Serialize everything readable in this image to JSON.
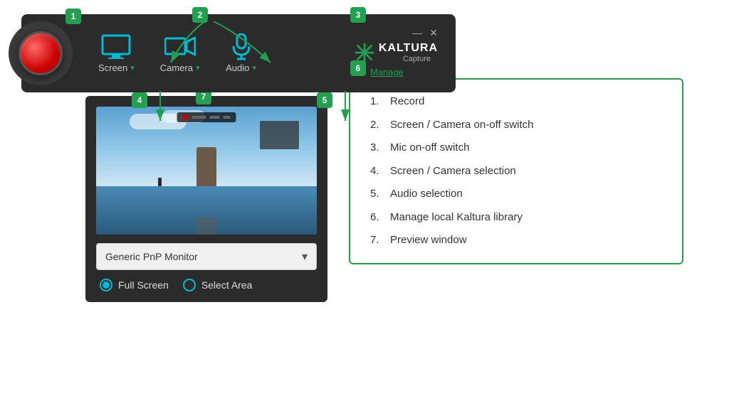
{
  "badges": {
    "b1": "1",
    "b2": "2",
    "b3": "3",
    "b7": "7",
    "b6": "6",
    "b4": "4",
    "b5": "5"
  },
  "toolbar": {
    "screen_label": "Screen",
    "camera_label": "Camera",
    "audio_label": "Audio"
  },
  "kaltura": {
    "brand": "KALTURA",
    "sub": "Capture",
    "manage": "Manage"
  },
  "preview": {
    "monitor_label": "Generic PnP Monitor",
    "full_screen": "Full Screen",
    "select_area": "Select Area"
  },
  "info": {
    "items": [
      {
        "num": "1.",
        "text": "Record"
      },
      {
        "num": "2.",
        "text": "Screen / Camera on-off switch"
      },
      {
        "num": "3.",
        "text": "Mic on-off switch"
      },
      {
        "num": "4.",
        "text": "Screen / Camera selection"
      },
      {
        "num": "5.",
        "text": "Audio selection"
      },
      {
        "num": "6.",
        "text": "Manage local Kaltura library"
      },
      {
        "num": "7.",
        "text": "Preview window"
      }
    ]
  },
  "window_controls": {
    "minimize": "—",
    "close": "✕"
  }
}
